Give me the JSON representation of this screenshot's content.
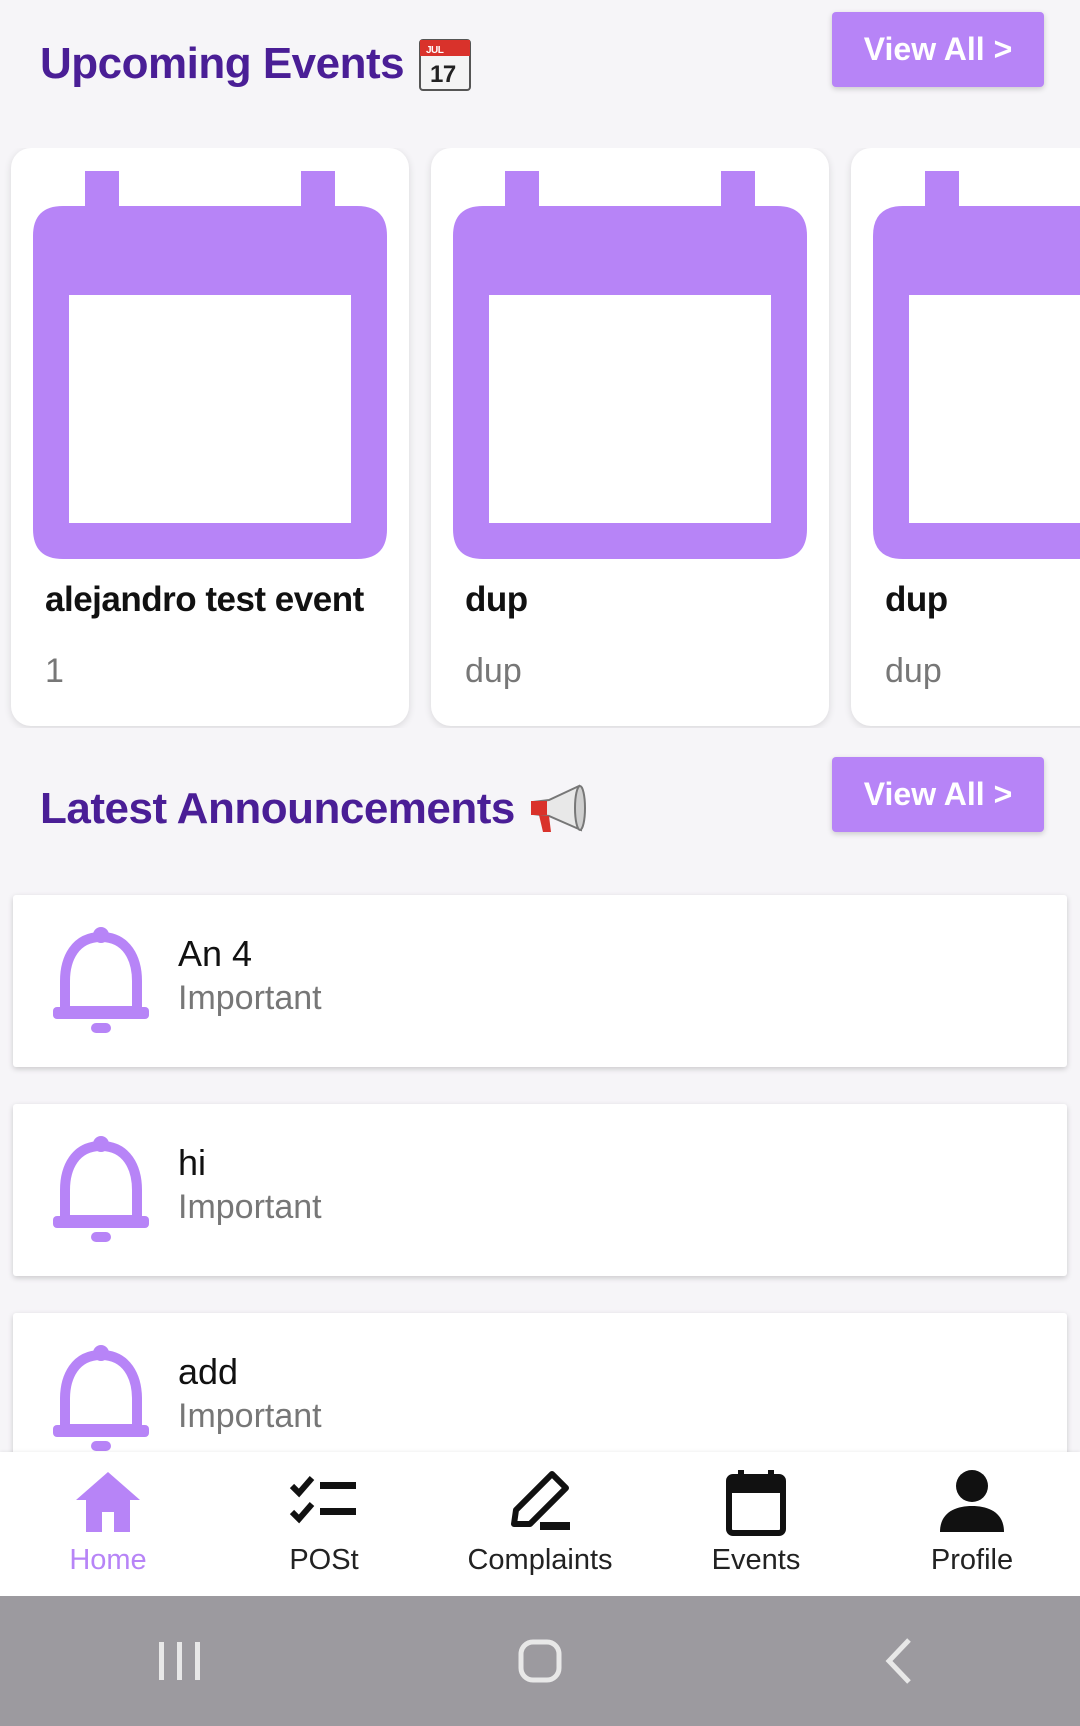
{
  "events_section": {
    "title": "Upcoming Events",
    "view_all_label": "View All >",
    "cards": [
      {
        "title": "alejandro test event",
        "subtitle": "1"
      },
      {
        "title": "dup",
        "subtitle": "dup"
      },
      {
        "title": "dup",
        "subtitle": "dup"
      }
    ]
  },
  "announcements_section": {
    "title": "Latest Announcements",
    "view_all_label": "View All >",
    "items": [
      {
        "title": "An 4",
        "subtitle": "Important"
      },
      {
        "title": "hi",
        "subtitle": "Important"
      },
      {
        "title": "add",
        "subtitle": "Important"
      }
    ]
  },
  "bottom_nav": {
    "items": [
      {
        "label": "Home",
        "icon": "home-icon",
        "active": true
      },
      {
        "label": "POSt",
        "icon": "checklist-icon"
      },
      {
        "label": "Complaints",
        "icon": "pencil-icon"
      },
      {
        "label": "Events",
        "icon": "calendar-icon"
      },
      {
        "label": "Profile",
        "icon": "person-icon"
      }
    ]
  },
  "colors": {
    "accent": "#b784f7",
    "heading": "#4a1e96",
    "background": "#f6f5f8",
    "system_bar": "#9c9a9f"
  }
}
